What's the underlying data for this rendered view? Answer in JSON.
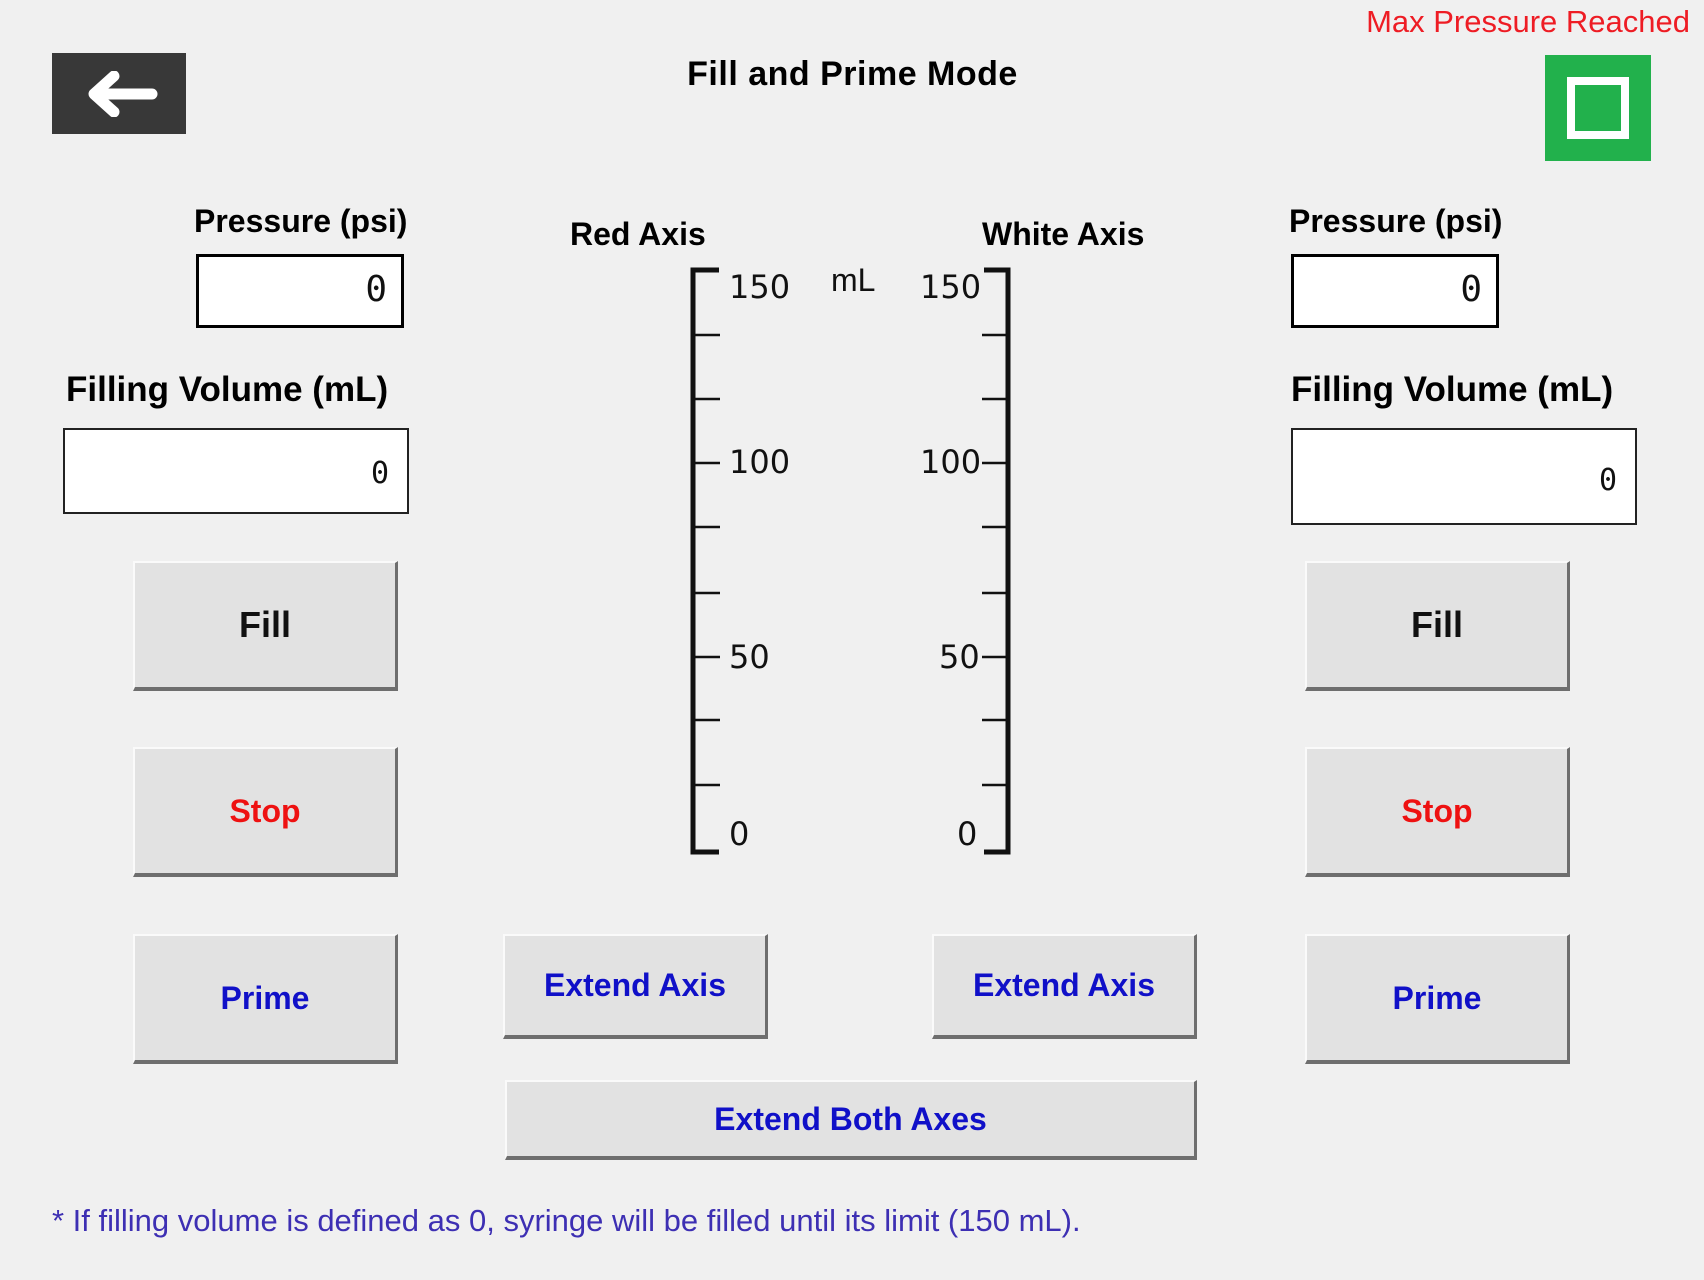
{
  "header": {
    "title": "Fill and Prime Mode",
    "warning": "Max Pressure Reached"
  },
  "left": {
    "pressure_label": "Pressure (psi)",
    "pressure_value": "0",
    "volume_label": "Filling Volume (mL)",
    "volume_value": "0",
    "fill_label": "Fill",
    "stop_label": "Stop",
    "prime_label": "Prime",
    "extend_label": "Extend Axis"
  },
  "right": {
    "pressure_label": "Pressure (psi)",
    "pressure_value": "0",
    "volume_label": "Filling Volume (mL)",
    "volume_value": "0",
    "fill_label": "Fill",
    "stop_label": "Stop",
    "prime_label": "Prime",
    "extend_label": "Extend Axis"
  },
  "axes": {
    "red_title": "Red Axis",
    "white_title": "White Axis",
    "unit": "mL",
    "red_ticks": [
      "150",
      "100",
      "50",
      "0"
    ],
    "white_ticks": [
      "150",
      "100",
      "50",
      "0"
    ]
  },
  "extend_both_label": "Extend Both Axes",
  "footnote": "* If filling volume is defined as 0, syringe will be filled until its limit (150 mL).",
  "colors": {
    "back_button": "#383838",
    "status_indicator": "#22b14c",
    "warning": "#ee1c24",
    "stop_text": "#ee1111",
    "action_text": "#1010c8",
    "footnote_text": "#3d2fb3"
  },
  "icons": {
    "back": "arrow-left-icon",
    "status": "status-indicator-icon"
  }
}
